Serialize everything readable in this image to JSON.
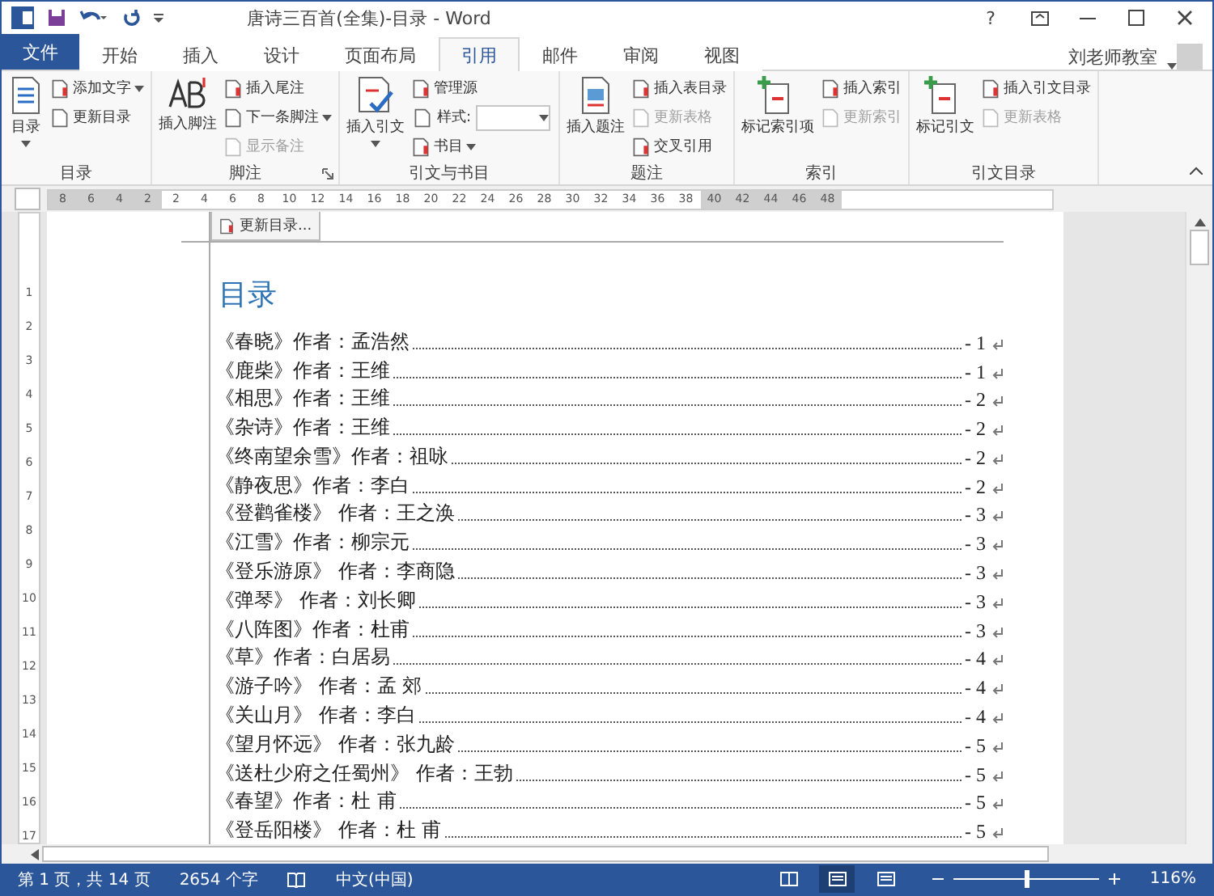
{
  "window": {
    "title": "唐诗三百首(全集)-目录 - Word",
    "user": "刘老师教室",
    "help": "?"
  },
  "file_tab": "文件",
  "tabs": [
    {
      "label": "开始",
      "selected": false
    },
    {
      "label": "插入",
      "selected": false
    },
    {
      "label": "设计",
      "selected": false
    },
    {
      "label": "页面布局",
      "selected": false
    },
    {
      "label": "引用",
      "selected": true
    },
    {
      "label": "邮件",
      "selected": false
    },
    {
      "label": "审阅",
      "selected": false
    },
    {
      "label": "视图",
      "selected": false
    }
  ],
  "ribbon": [
    {
      "title": "目录",
      "items": [
        {
          "kind": "large-menu",
          "label": "目录"
        },
        {
          "kind": "small-menu",
          "label": "添加文字",
          "disabled": false
        },
        {
          "kind": "small",
          "label": "更新目录",
          "disabled": false
        }
      ]
    },
    {
      "title": "脚注",
      "launcher": true,
      "items": [
        {
          "kind": "large",
          "label": "插入脚注"
        },
        {
          "kind": "small",
          "label": "插入尾注",
          "disabled": false
        },
        {
          "kind": "small-menu",
          "label": "下一条脚注",
          "disabled": false
        },
        {
          "kind": "small",
          "label": "显示备注",
          "disabled": true
        }
      ]
    },
    {
      "title": "引文与书目",
      "items": [
        {
          "kind": "large-menu",
          "label": "插入引文"
        },
        {
          "kind": "small",
          "label": "管理源",
          "disabled": false
        },
        {
          "kind": "combo",
          "label": "样式:"
        },
        {
          "kind": "small-menu",
          "label": "书目",
          "disabled": false
        }
      ]
    },
    {
      "title": "题注",
      "items": [
        {
          "kind": "large",
          "label": "插入题注"
        },
        {
          "kind": "small",
          "label": "插入表目录",
          "disabled": false
        },
        {
          "kind": "small",
          "label": "更新表格",
          "disabled": true
        },
        {
          "kind": "small",
          "label": "交叉引用",
          "disabled": false
        }
      ]
    },
    {
      "title": "索引",
      "items": [
        {
          "kind": "large",
          "label": "标记索引项"
        },
        {
          "kind": "small",
          "label": "插入索引",
          "disabled": false
        },
        {
          "kind": "small",
          "label": "更新索引",
          "disabled": true
        }
      ]
    },
    {
      "title": "引文目录",
      "items": [
        {
          "kind": "large",
          "label": "标记引文"
        },
        {
          "kind": "small",
          "label": "插入引文目录",
          "disabled": false
        },
        {
          "kind": "small",
          "label": "更新表格",
          "disabled": true
        }
      ]
    }
  ],
  "ruler": [
    {
      "label": "8",
      "margin": true
    },
    {
      "label": "6",
      "margin": true
    },
    {
      "label": "4",
      "margin": true
    },
    {
      "label": "2",
      "margin": true
    },
    {
      "label": "2",
      "margin": false
    },
    {
      "label": "4",
      "margin": false
    },
    {
      "label": "6",
      "margin": false
    },
    {
      "label": "8",
      "margin": false
    },
    {
      "label": "10",
      "margin": false
    },
    {
      "label": "12",
      "margin": false
    },
    {
      "label": "14",
      "margin": false
    },
    {
      "label": "16",
      "margin": false
    },
    {
      "label": "18",
      "margin": false
    },
    {
      "label": "20",
      "margin": false
    },
    {
      "label": "22",
      "margin": false
    },
    {
      "label": "24",
      "margin": false
    },
    {
      "label": "26",
      "margin": false
    },
    {
      "label": "28",
      "margin": false
    },
    {
      "label": "30",
      "margin": false
    },
    {
      "label": "32",
      "margin": false
    },
    {
      "label": "34",
      "margin": false
    },
    {
      "label": "36",
      "margin": false
    },
    {
      "label": "38",
      "margin": false
    },
    {
      "label": "40",
      "margin": true
    },
    {
      "label": "42",
      "margin": true
    },
    {
      "label": "44",
      "margin": true
    },
    {
      "label": "46",
      "margin": true
    },
    {
      "label": "48",
      "margin": true
    }
  ],
  "vruler": [
    "1",
    "2",
    "3",
    "4",
    "5",
    "6",
    "7",
    "8",
    "9",
    "10",
    "11",
    "12",
    "13",
    "14",
    "15",
    "16",
    "17"
  ],
  "toc_control": {
    "label": "更新目录..."
  },
  "document": {
    "heading": "目录",
    "entries": [
      {
        "text": "《春晓》作者：孟浩然",
        "page": "- 1"
      },
      {
        "text": "《鹿柴》作者：王维",
        "page": "- 1"
      },
      {
        "text": "《相思》作者：王维",
        "page": "- 2"
      },
      {
        "text": "《杂诗》作者：王维",
        "page": "- 2"
      },
      {
        "text": "《终南望余雪》作者：祖咏",
        "page": "- 2"
      },
      {
        "text": "《静夜思》作者：李白",
        "page": "- 2"
      },
      {
        "text": "《登鹳雀楼》 作者：王之涣",
        "page": "- 3"
      },
      {
        "text": "《江雪》作者：柳宗元",
        "page": "- 3"
      },
      {
        "text": "《登乐游原》 作者：李商隐",
        "page": "- 3"
      },
      {
        "text": "《弹琴》 作者：刘长卿",
        "page": "- 3"
      },
      {
        "text": "《八阵图》作者：杜甫",
        "page": "- 3"
      },
      {
        "text": "《草》作者：白居易",
        "page": "- 4"
      },
      {
        "text": "《游子吟》 作者：孟 郊",
        "page": "- 4"
      },
      {
        "text": "《关山月》 作者：李白",
        "page": "- 4"
      },
      {
        "text": "《望月怀远》 作者：张九龄",
        "page": "- 5"
      },
      {
        "text": "《送杜少府之任蜀州》 作者：王勃",
        "page": "- 5"
      },
      {
        "text": "《春望》作者：杜 甫",
        "page": "- 5"
      },
      {
        "text": "《登岳阳楼》 作者：杜 甫",
        "page": "- 5"
      }
    ]
  },
  "status_bar": {
    "page": "第 1 页，共 14 页",
    "words": "2654 个字",
    "language": "中文(中国)",
    "zoom": {
      "level": 0.5,
      "reading": "116%"
    },
    "views": [
      {
        "selected": false
      },
      {
        "selected": true
      },
      {
        "selected": false
      }
    ]
  }
}
